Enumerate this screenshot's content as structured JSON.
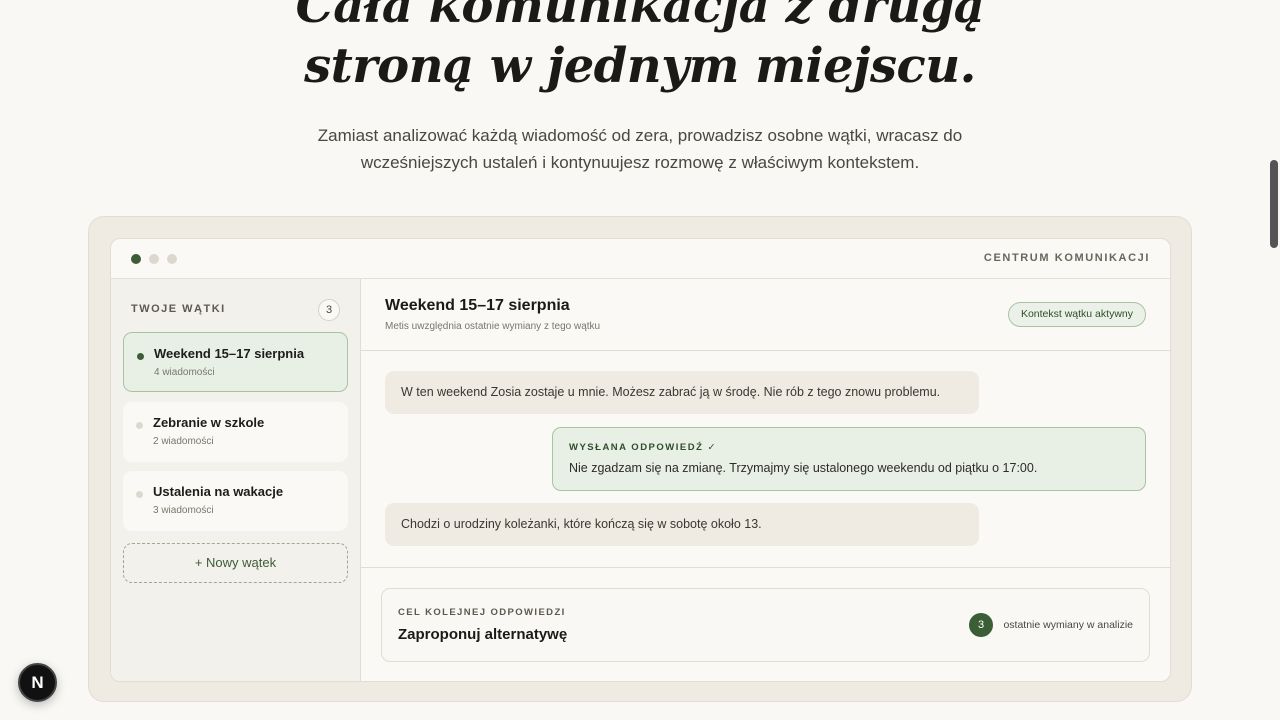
{
  "hero": {
    "title_line1": "Cała komunikacja z drugą",
    "title_line2": "stroną w jednym miejscu.",
    "subtitle": "Zamiast analizować każdą wiadomość od zera, prowadzisz osobne wątki, wracasz do wcześniejszych ustaleń i kontynuujesz rozmowę z właściwym kontekstem."
  },
  "window": {
    "title": "CENTRUM KOMUNIKACJI"
  },
  "sidebar": {
    "heading": "TWOJE WĄTKI",
    "count": "3",
    "threads": [
      {
        "title": "Weekend 15–17 sierpnia",
        "meta": "4 wiadomości",
        "active": true
      },
      {
        "title": "Zebranie w szkole",
        "meta": "2 wiadomości",
        "active": false
      },
      {
        "title": "Ustalenia na wakacje",
        "meta": "3 wiadomości",
        "active": false
      }
    ],
    "new_thread_label": "+ Nowy wątek"
  },
  "thread": {
    "title": "Weekend 15–17 sierpnia",
    "hint": "Metis uwzględnia ostatnie wymiany z tego wątku",
    "context_badge": "Kontekst wątku aktywny",
    "messages": [
      {
        "type": "incoming",
        "text": "W ten weekend Zosia zostaje u mnie. Możesz zabrać ją w środę. Nie rób z tego znowu problemu."
      },
      {
        "type": "sent",
        "label": "WYSŁANA ODPOWIEDŹ ✓",
        "text": "Nie zgadzam się na zmianę. Trzymajmy się ustalonego weekendu od piątku o 17:00."
      },
      {
        "type": "incoming",
        "text": "Chodzi o urodziny koleżanki, które kończą się w sobotę około 13."
      }
    ]
  },
  "goal": {
    "label": "CEL KOLEJNEJ ODPOWIEDZI",
    "value": "Zaproponuj alternatywę",
    "count": "3",
    "note": "ostatnie wymiany w analizie"
  },
  "fab": {
    "label": "N"
  },
  "colors": {
    "accent": "#3b5e36",
    "background": "#f9f8f5",
    "frame": "#efebe3"
  }
}
